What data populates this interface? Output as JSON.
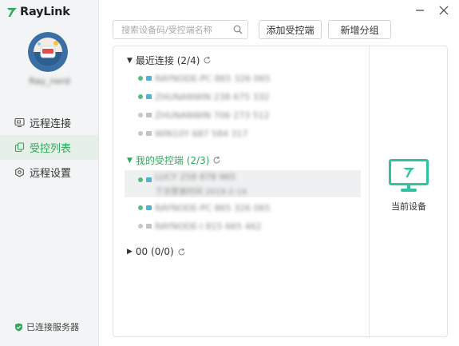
{
  "app": {
    "name": "RayLink",
    "brand_color": "#2fa95c",
    "monitor_color": "#2fc3a0"
  },
  "user": {
    "name": "Ray_nerd"
  },
  "nav": {
    "items": [
      {
        "id": "remote-connect",
        "label": "远程连接",
        "icon": "monitor-icon",
        "active": false
      },
      {
        "id": "device-list",
        "label": "受控列表",
        "icon": "copy-icon",
        "active": true
      },
      {
        "id": "remote-settings",
        "label": "远程设置",
        "icon": "gear-icon",
        "active": false
      }
    ]
  },
  "status": {
    "label": "已连接服务器",
    "color": "#2fa95c"
  },
  "toolbar": {
    "search_placeholder": "搜索设备码/受控端名称",
    "add_controlled_label": "添加受控端",
    "new_group_label": "新增分组"
  },
  "groups": [
    {
      "title": "最近连接 (2/4)",
      "expanded": true,
      "highlight": false,
      "devices": [
        {
          "name": "RAYNODE-PC 865 326 065",
          "online": true
        },
        {
          "name": "ZHUNANWIN 238 675 332",
          "online": true
        },
        {
          "name": "ZHUNANWIN 706 273 512",
          "online": false
        },
        {
          "name": "WIN10Y 687 584 317",
          "online": false
        }
      ]
    },
    {
      "title": "我的受控端 (2/3)",
      "expanded": true,
      "highlight": true,
      "devices": [
        {
          "name": "LUCY 258 878 965",
          "sub": "下次登录时间 2019-2-14",
          "online": true
        },
        {
          "name": "RAYNODE-PC 865 326 065",
          "online": true
        },
        {
          "name": "RAYNODE-I 815 665 462",
          "online": false
        }
      ]
    },
    {
      "title": "00 (0/0)",
      "expanded": false,
      "highlight": false,
      "devices": []
    }
  ],
  "current_device": {
    "label": "当前设备"
  }
}
